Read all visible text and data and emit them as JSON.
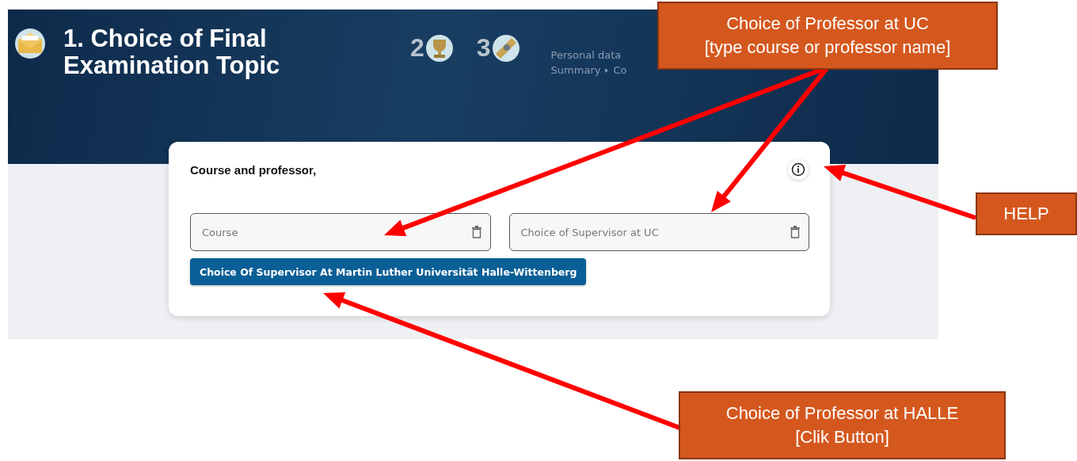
{
  "header": {
    "title_lines": [
      "1. Choice of Final",
      "Examination Topic"
    ],
    "steps": [
      {
        "number": "2",
        "kind": "trophy"
      },
      {
        "number": "3",
        "kind": "diploma"
      }
    ],
    "breadcrumb": [
      [
        "Personal data"
      ],
      [
        "Summary",
        "Co"
      ]
    ]
  },
  "card": {
    "title": "Course and professor,",
    "fields": [
      {
        "placeholder": "Course"
      },
      {
        "placeholder": "Choice of Supervisor at UC"
      }
    ],
    "button": "Choice Of Supervisor At Martin Luther Universität Halle-Wittenberg"
  },
  "annotations": [
    {
      "kind": "callout",
      "lines": [
        "Choice of Professor at UC",
        "[type course or professor name]"
      ]
    },
    {
      "kind": "callout",
      "lines": [
        "HELP"
      ]
    },
    {
      "kind": "callout",
      "lines": [
        "Choice of Professor at HALLE",
        "[Clik Button]"
      ]
    }
  ]
}
